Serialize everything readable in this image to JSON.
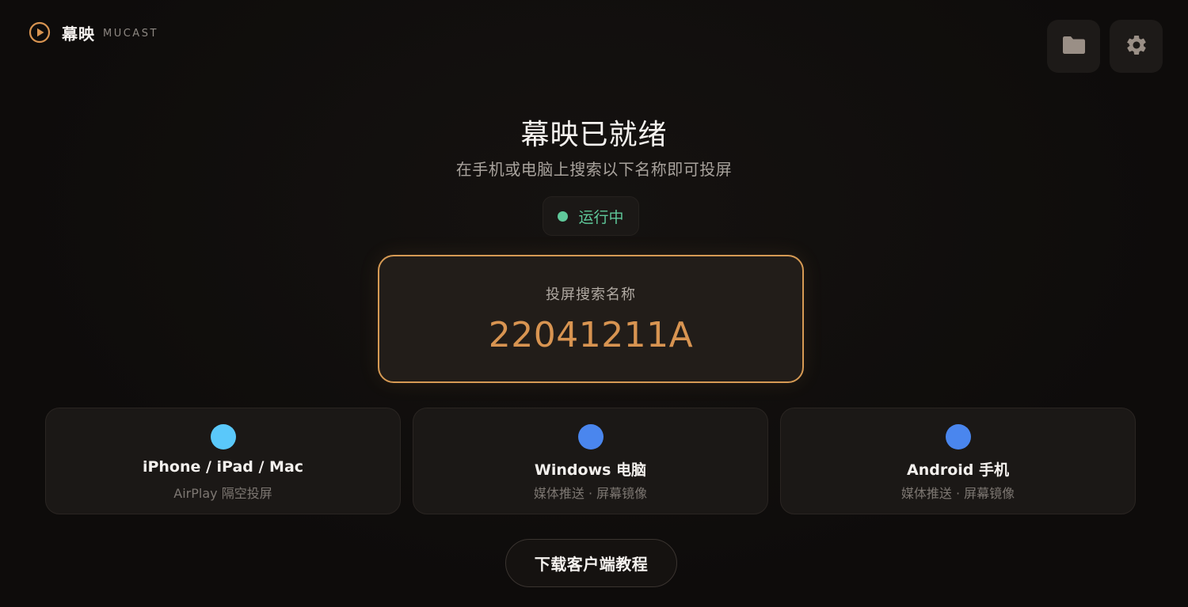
{
  "brand": {
    "name": "幕映",
    "subtitle": "MUCAST",
    "icon": "play-circle-icon"
  },
  "toolbar": {
    "folder_icon": "folder-icon",
    "settings_icon": "gear-icon"
  },
  "hero": {
    "title": "幕映已就绪",
    "subtitle": "在手机或电脑上搜索以下名称即可投屏"
  },
  "status": {
    "text": "运行中",
    "color": "#5fc89a"
  },
  "cast_name": {
    "label": "投屏搜索名称",
    "value": "22041211A",
    "accent": "#d89451"
  },
  "devices": [
    {
      "title": "iPhone / iPad / Mac",
      "desc": "AirPlay 隔空投屏",
      "color": "#5ac8fa"
    },
    {
      "title": "Windows 电脑",
      "desc": "媒体推送 · 屏幕镜像",
      "color": "#4a86ee"
    },
    {
      "title": "Android 手机",
      "desc": "媒体推送 · 屏幕镜像",
      "color": "#4a86ee"
    }
  ],
  "download_button": "下载客户端教程"
}
